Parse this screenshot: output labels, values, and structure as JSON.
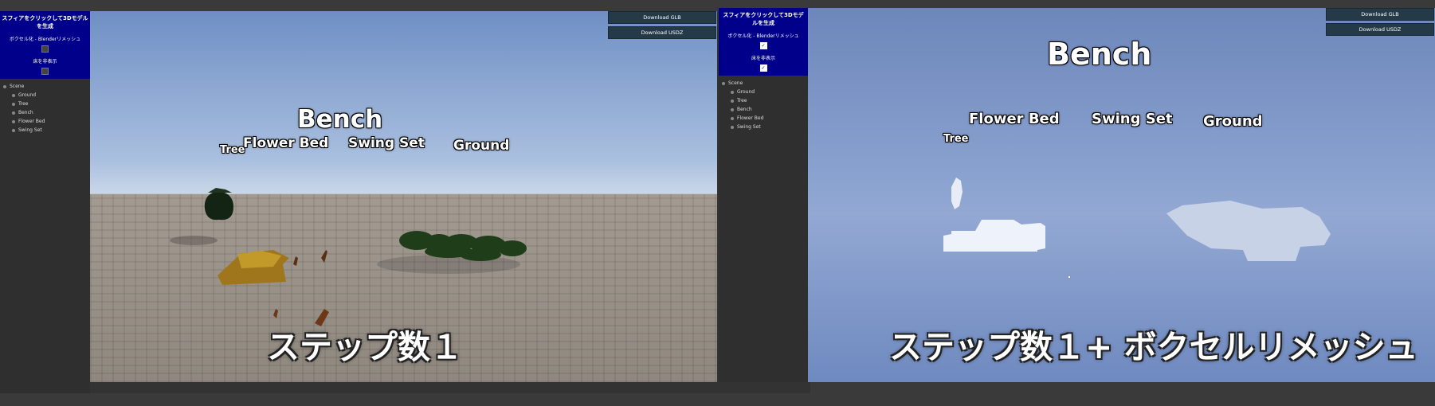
{
  "left": {
    "sidebar": {
      "title": "スフィアをクリックして3Dモデルを生成",
      "voxel_label": "ボクセル化 - Blenderリメッシュ",
      "voxel_checked": false,
      "floor_label": "床を非表示",
      "floor_checked": false,
      "tree": {
        "root": "Scene",
        "children": [
          "Ground",
          "Tree",
          "Bench",
          "Flower Bed",
          "Swing Set"
        ]
      }
    },
    "buttons": {
      "download_glb": "Download GLB",
      "download_usdz": "Download USDZ"
    },
    "labels": {
      "bench": "Bench",
      "flower_bed": "Flower Bed",
      "swing_set": "Swing Set",
      "ground": "Ground",
      "tree": "Tree"
    },
    "caption": "ステップ数１"
  },
  "right": {
    "sidebar": {
      "title": "スフィアをクリックして3Dモデルを生成",
      "voxel_label": "ボクセル化 - Blenderリメッシュ",
      "voxel_checked": true,
      "floor_label": "床を非表示",
      "floor_checked": true,
      "tree": {
        "root": "Scene",
        "children": [
          "Ground",
          "Tree",
          "Bench",
          "Flower Bed",
          "Swing Set"
        ]
      }
    },
    "buttons": {
      "download_glb": "Download GLB",
      "download_usdz": "Download USDZ"
    },
    "labels": {
      "bench": "Bench",
      "flower_bed": "Flower Bed",
      "swing_set": "Swing Set",
      "ground": "Ground",
      "tree": "Tree"
    },
    "caption": "ステップ数１+ ボクセルリメッシュ"
  }
}
